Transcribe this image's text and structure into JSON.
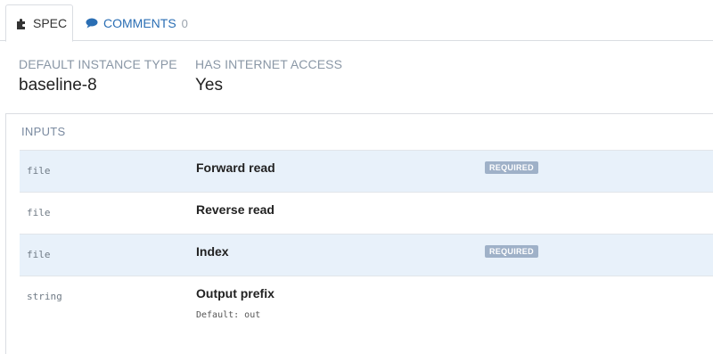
{
  "tabs": [
    {
      "label": "SPEC",
      "icon": "puzzle-icon"
    },
    {
      "label": "COMMENTS",
      "icon": "comment-icon",
      "count": "0"
    }
  ],
  "meta": {
    "instance_type_label": "DEFAULT INSTANCE TYPE",
    "instance_type_value": "baseline-8",
    "internet_label": "HAS INTERNET ACCESS",
    "internet_value": "Yes"
  },
  "inputs": {
    "title": "INPUTS",
    "rows": [
      {
        "type": "file",
        "name": "Forward read",
        "badge": "REQUIRED"
      },
      {
        "type": "file",
        "name": "Reverse read"
      },
      {
        "type": "file",
        "name": "Index",
        "badge": "REQUIRED"
      },
      {
        "type": "string",
        "name": "Output prefix",
        "default": "Default: out"
      }
    ]
  },
  "colors": {
    "accent": "#2a6eb4",
    "row_highlight": "#e8f1fa",
    "badge": "#9fb1c8"
  }
}
